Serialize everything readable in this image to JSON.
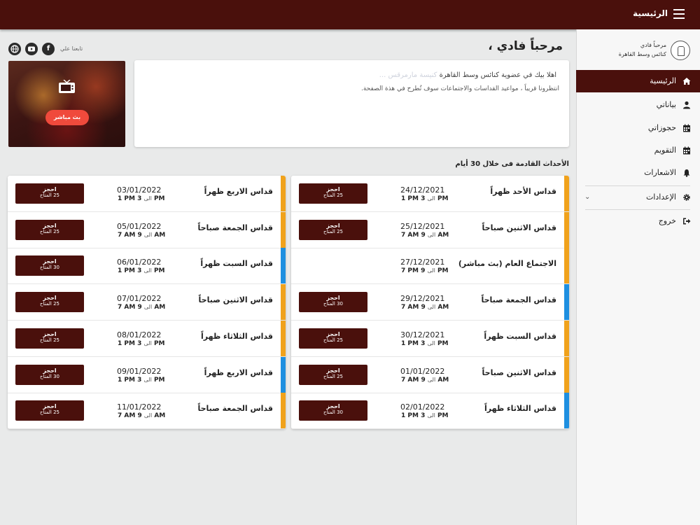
{
  "topbar": {
    "title": "الرئيسية",
    "menu_icon": "hamburger-icon"
  },
  "sidebar": {
    "greeting": "مرحباً فادي",
    "org_name": "كنائس وسط القاهرة",
    "items": [
      {
        "label": "الرئيسية",
        "icon": "home-icon",
        "active": true
      },
      {
        "label": "بياناتي",
        "icon": "user-icon"
      },
      {
        "label": "حجوزاتي",
        "icon": "calendar-icon"
      },
      {
        "label": "التقويم",
        "icon": "calendar-icon"
      },
      {
        "label": "الاشعارات",
        "icon": "bell-icon"
      },
      {
        "label": "الإعدادات",
        "icon": "gear-icon",
        "chevron": "⌄"
      },
      {
        "label": "خروج",
        "icon": "logout-icon"
      }
    ]
  },
  "header": {
    "welcome": "مرحباً فادي ،",
    "follow_label": "تابعنا علي",
    "social": [
      "facebook",
      "youtube",
      "website"
    ]
  },
  "live": {
    "button_label": "بث مباشر",
    "icon": "tv-icon"
  },
  "message": {
    "line1_main": "اهلا بيك في عضوية كنائس وسط القاهرة",
    "line1_faded": "كنيسة مارمرقس ...",
    "line2": "انتظرونا قريباً ، مواعيد القداسات والاجتماعات سوف تُطرح في هذة الصفحة."
  },
  "section_title": "الأحداث القادمة فى خلال 30 أيام",
  "colors": {
    "brand": "#4a100c",
    "orange": "#f0a21c",
    "blue": "#1e8fe0",
    "live": "#f04a3c"
  },
  "book": {
    "label": "احجز",
    "to_word": "الى"
  },
  "events_right": [
    {
      "title": "قداس الأحد ظهراً",
      "date": "24/12/2021",
      "start": "1 PM",
      "end": "3 PM",
      "avail": "25 المتاح",
      "stripe": "orange",
      "bookable": true
    },
    {
      "title": "قداس الاثنين صباحاً",
      "date": "25/12/2021",
      "start": "7 AM",
      "end": "9 AM",
      "avail": "25 المتاح",
      "stripe": "orange",
      "bookable": true
    },
    {
      "title": "الاجتماع العام (بث مباشر)",
      "date": "27/12/2021",
      "start": "7 PM",
      "end": "9 PM",
      "avail": "",
      "stripe": "orange",
      "bookable": false
    },
    {
      "title": "قداس الجمعة صباحاً",
      "date": "29/12/2021",
      "start": "7 AM",
      "end": "9 AM",
      "avail": "30 المتاح",
      "stripe": "blue",
      "bookable": true
    },
    {
      "title": "قداس السبت ظهراً",
      "date": "30/12/2021",
      "start": "1 PM",
      "end": "3 PM",
      "avail": "25 المتاح",
      "stripe": "orange",
      "bookable": true
    },
    {
      "title": "قداس الاثنين صباحاً",
      "date": "01/01/2022",
      "start": "7 AM",
      "end": "9 AM",
      "avail": "25 المتاح",
      "stripe": "orange",
      "bookable": true
    },
    {
      "title": "قداس الثلاثاء ظهراً",
      "date": "02/01/2022",
      "start": "1 PM",
      "end": "3 PM",
      "avail": "30 المتاح",
      "stripe": "blue",
      "bookable": true
    }
  ],
  "events_left": [
    {
      "title": "قداس الاربع ظهراً",
      "date": "03/01/2022",
      "start": "1 PM",
      "end": "3 PM",
      "avail": "25 المتاح",
      "stripe": "orange",
      "bookable": true
    },
    {
      "title": "قداس الجمعة صباحاً",
      "date": "05/01/2022",
      "start": "7 AM",
      "end": "9 AM",
      "avail": "25 المتاح",
      "stripe": "orange",
      "bookable": true
    },
    {
      "title": "قداس السبت ظهراً",
      "date": "06/01/2022",
      "start": "1 PM",
      "end": "3 PM",
      "avail": "30 المتاح",
      "stripe": "blue",
      "bookable": true
    },
    {
      "title": "قداس الاثنين صباحاً",
      "date": "07/01/2022",
      "start": "7 AM",
      "end": "9 AM",
      "avail": "25 المتاح",
      "stripe": "orange",
      "bookable": true
    },
    {
      "title": "قداس الثلاثاء ظهراً",
      "date": "08/01/2022",
      "start": "1 PM",
      "end": "3 PM",
      "avail": "25 المتاح",
      "stripe": "orange",
      "bookable": true
    },
    {
      "title": "قداس الاربع ظهراً",
      "date": "09/01/2022",
      "start": "1 PM",
      "end": "3 PM",
      "avail": "30 المتاح",
      "stripe": "blue",
      "bookable": true
    },
    {
      "title": "قداس الجمعة صباحاً",
      "date": "11/01/2022",
      "start": "7 AM",
      "end": "9 AM",
      "avail": "25 المتاح",
      "stripe": "orange",
      "bookable": true
    }
  ]
}
